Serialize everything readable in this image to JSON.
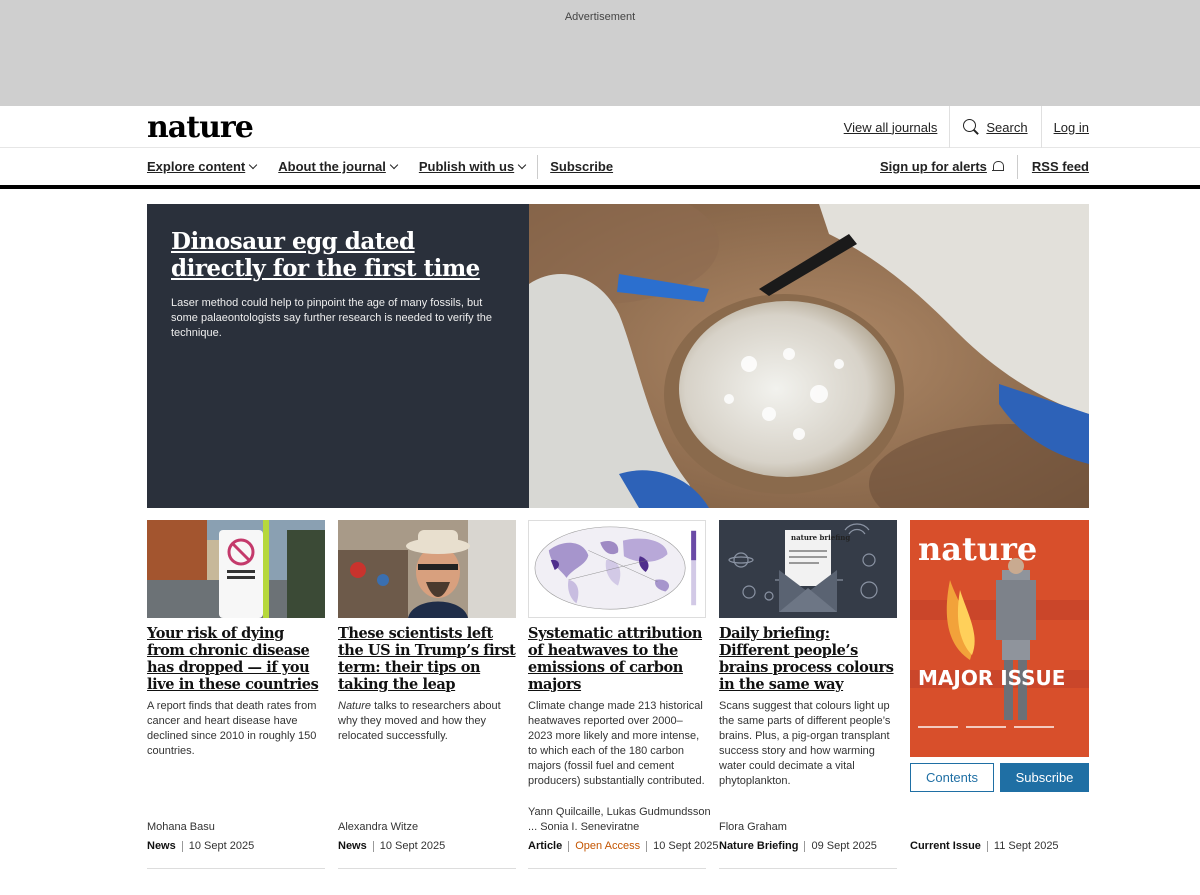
{
  "ad": {
    "label": "Advertisement"
  },
  "header": {
    "logo": "nature",
    "view_all_journals": "View all journals",
    "search": "Search",
    "login": "Log in"
  },
  "nav": {
    "items": [
      "Explore content",
      "About the journal",
      "Publish with us"
    ],
    "subscribe": "Subscribe",
    "alerts": "Sign up for alerts",
    "rss": "RSS feed"
  },
  "hero": {
    "title": "Dinosaur egg dated directly for the first time",
    "subtitle": "Laser method could help to pinpoint the age of many fossils, but some palaeontologists say further research is needed to verify the technique."
  },
  "cards": [
    {
      "title": "Your risk of dying from chronic disease has dropped — if you live in these countries",
      "desc": "A report finds that death rates from cancer and heart disease have declined since 2010 in roughly 150 countries.",
      "author": "Mohana Basu",
      "type": "News",
      "date": "10 Sept 2025"
    },
    {
      "title": "These scientists left the US in Trump’s first term: their tips on taking the leap",
      "desc_em": "Nature",
      "desc": " talks to researchers about why they moved and how they relocated successfully.",
      "author": "Alexandra Witze",
      "type": "News",
      "date": "10 Sept 2025"
    },
    {
      "title": "Systematic attribution of heatwaves to the emissions of carbon majors",
      "desc": "Climate change made 213 historical heatwaves reported over 2000–2023 more likely and more intense, to which each of the 180 carbon majors (fossil fuel and cement producers) substantially contributed.",
      "author": "Yann Quilcaille, Lukas Gudmundsson",
      "author2": "... Sonia I. Seneviratne",
      "type": "Article",
      "access": "Open Access",
      "date": "10 Sept 2025"
    },
    {
      "title": "Daily briefing: Different people’s brains process colours in the same way",
      "desc": "Scans suggest that colours light up the same parts of different people’s brains. Plus, a pig-organ transplant success story and how warming water could decimate a vital phytoplankton.",
      "author": "Flora Graham",
      "type": "Nature Briefing",
      "date": "09 Sept 2025",
      "thumb_text": "nature briefing"
    },
    {
      "type": "Current Issue",
      "date": "11 Sept 2025",
      "cover_logo": "nature",
      "cover_headline": "MAJOR ISSUE",
      "contents_label": "Contents",
      "subscribe_label": "Subscribe"
    }
  ],
  "colors": {
    "hero_bg": "#2a303b",
    "link_blue": "#1f6fa4",
    "open_access": "#c45500",
    "cover_bg": "#d84f2b"
  }
}
